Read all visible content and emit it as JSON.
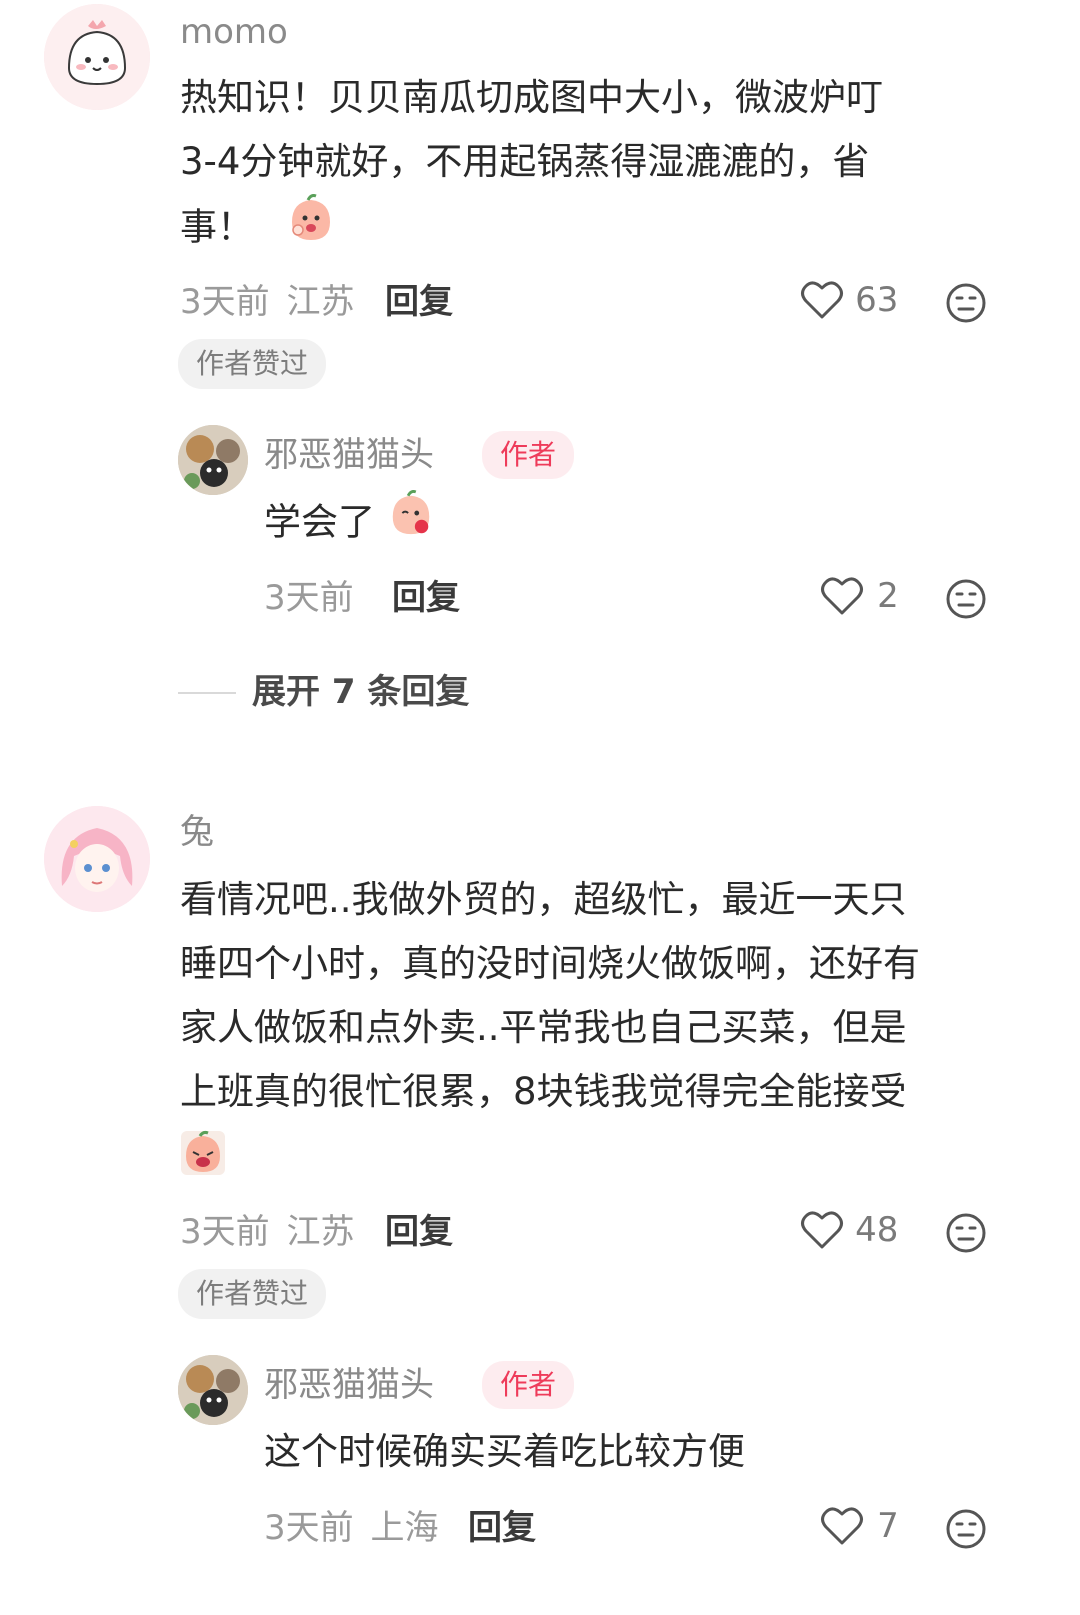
{
  "comments": [
    {
      "username": "momo",
      "text_lines": [
        "热知识！贝贝南瓜切成图中大小，微波炉叮",
        "3-4分钟就好，不用起锅蒸得湿漉漉的，省",
        "事！"
      ],
      "time": "3天前",
      "location": "江苏",
      "reply_label": "回复",
      "likes": "63",
      "badge": "作者赞过",
      "reply": {
        "username": "邪恶猫猫头",
        "author_tag": "作者",
        "text": "学会了",
        "time": "3天前",
        "location": "",
        "reply_label": "回复",
        "likes": "2"
      },
      "expand_label": "展开 7 条回复"
    },
    {
      "username": "兔",
      "text_lines": [
        "看情况吧..我做外贸的，超级忙，最近一天只",
        "睡四个小时，真的没时间烧火做饭啊，还好有",
        "家人做饭和点外卖..平常我也自己买菜，但是",
        "上班真的很忙很累，8块钱我觉得完全能接受"
      ],
      "time": "3天前",
      "location": "江苏",
      "reply_label": "回复",
      "likes": "48",
      "badge": "作者赞过",
      "reply": {
        "username": "邪恶猫猫头",
        "author_tag": "作者",
        "text": "这个时候确实买着吃比较方便",
        "time": "3天前",
        "location": "上海",
        "reply_label": "回复",
        "likes": "7"
      }
    }
  ],
  "icons": {
    "like": "heart-outline-icon",
    "dislike": "meh-face-icon",
    "sticker": "peach-mascot-sticker"
  },
  "colors": {
    "author_tag_text": "#ee3b5a",
    "author_tag_bg": "#fdecef",
    "badge_bg": "#f1f1f1"
  }
}
